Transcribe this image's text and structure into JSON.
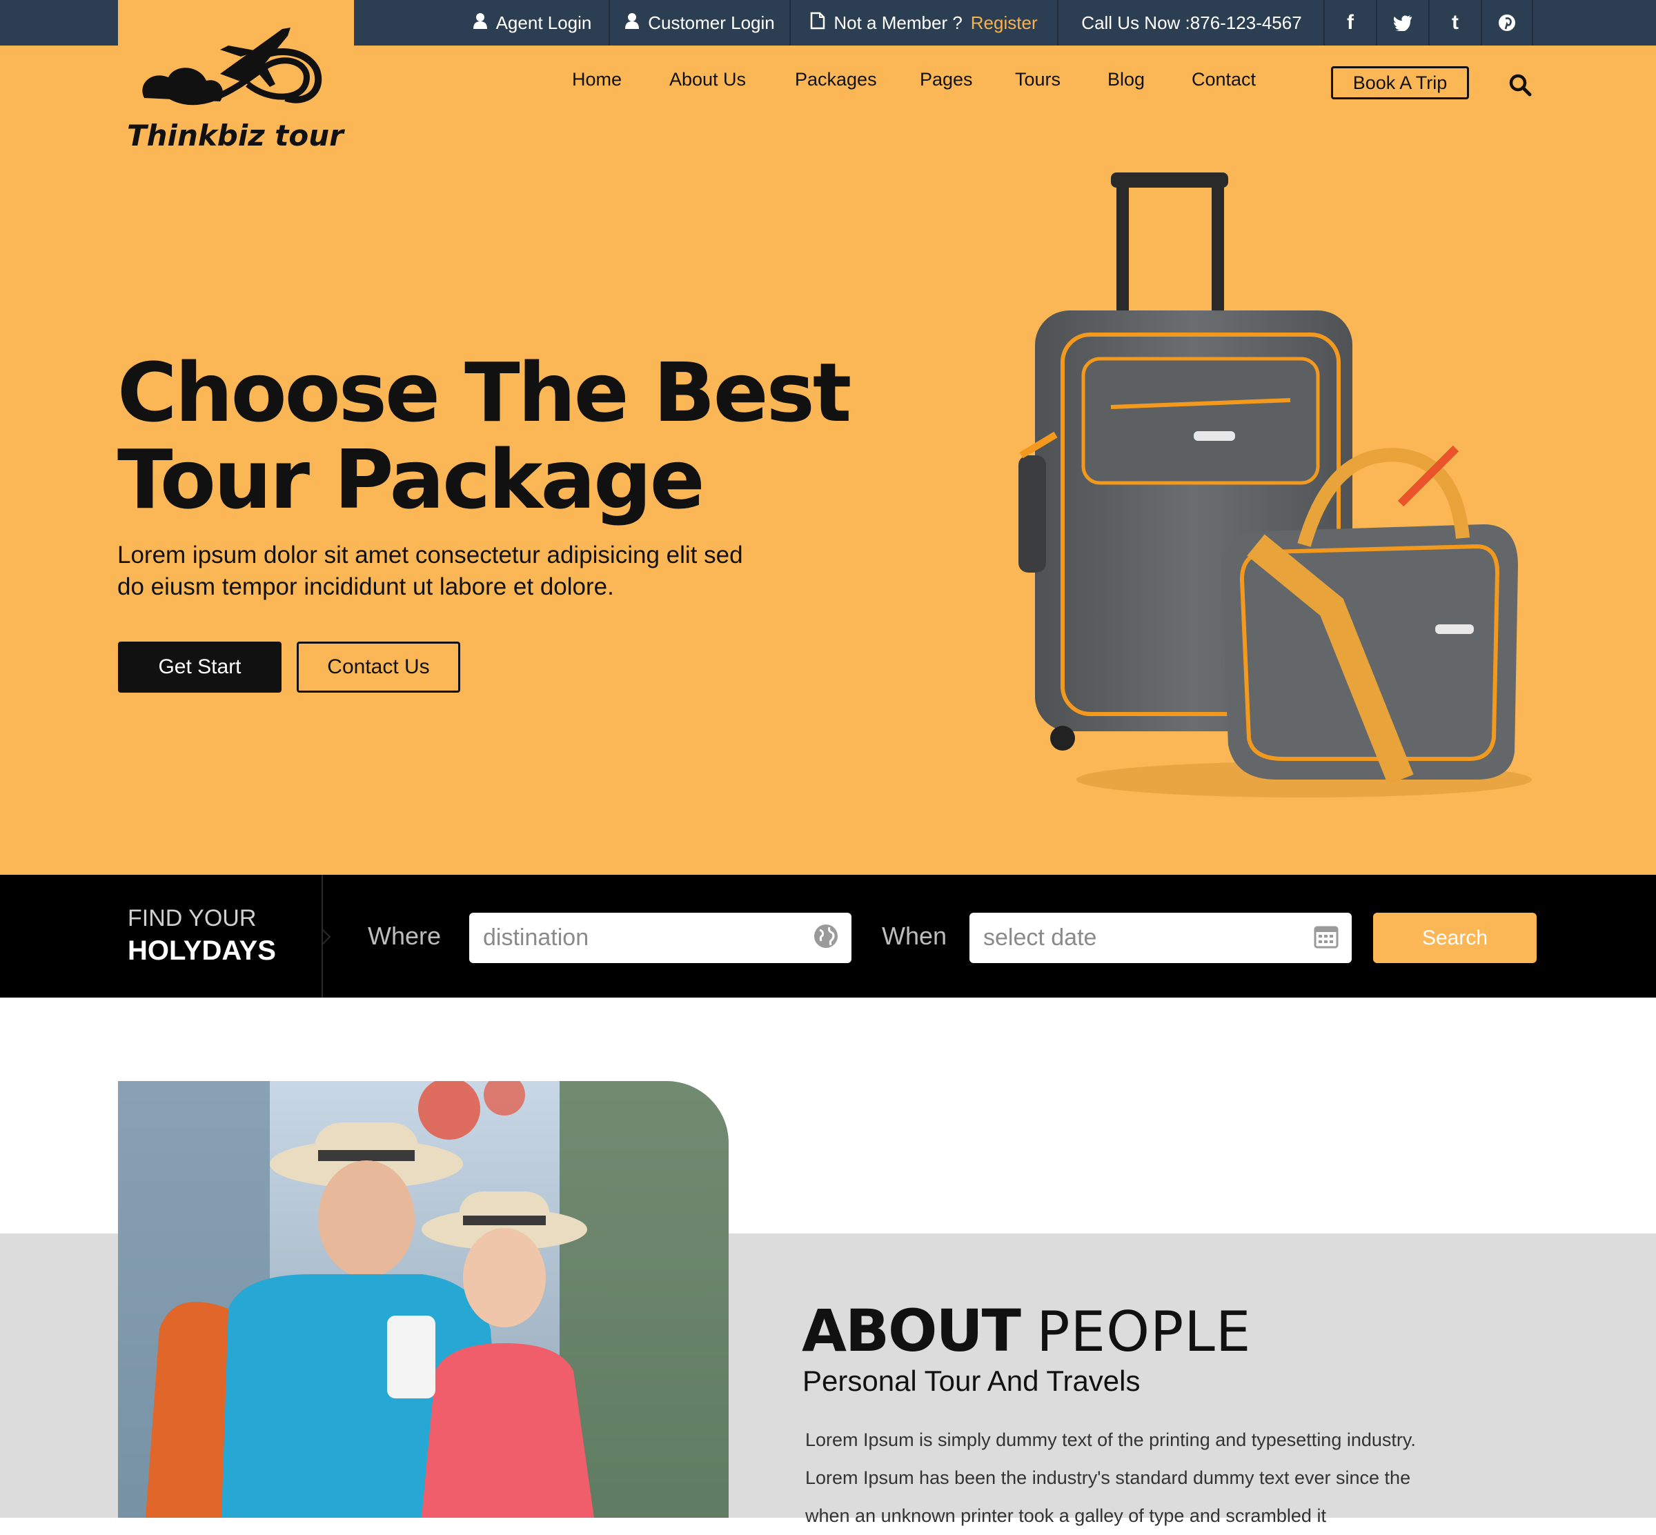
{
  "topbar": {
    "agent_login": "Agent Login",
    "customer_login": "Customer Login",
    "not_member": "Not a Member ?",
    "register": "Register",
    "call": "Call Us Now :876-123-4567"
  },
  "brand": {
    "name": "Thinkbiz tour"
  },
  "nav": {
    "home": "Home",
    "about": "About Us",
    "packages": "Packages",
    "pages": "Pages",
    "tours": "Tours",
    "blog": "Blog",
    "contact": "Contact",
    "book": "Book A Trip"
  },
  "hero": {
    "title_line1": "Choose The Best",
    "title_line2": "Tour Package",
    "subtitle_line1": "Lorem ipsum dolor sit amet consectetur adipisicing elit sed",
    "subtitle_line2": "do eiusm tempor incididunt ut labore et dolore.",
    "primary_btn": "Get Start",
    "secondary_btn": "Contact Us"
  },
  "search": {
    "heading_small": "FIND YOUR",
    "heading_big": "HOLYDAYS",
    "where_label": "Where",
    "where_placeholder": "distination",
    "when_label": "When",
    "when_placeholder": "select date",
    "button": "Search"
  },
  "about": {
    "title_bold": "ABOUT",
    "title_light": "PEOPLE",
    "subtitle": "Personal Tour And Travels",
    "text": "Lorem Ipsum is simply dummy text of the printing and typesetting industry. Lorem Ipsum has been the industry's standard dummy text ever since the when an unknown printer took a galley of type and scrambled it"
  },
  "colors": {
    "accent": "#fbb655",
    "topbar": "#2c3e52",
    "dark": "#000000"
  },
  "icons": [
    "user-icon",
    "document-icon",
    "facebook-icon",
    "twitter-icon",
    "tumblr-icon",
    "pinterest-icon",
    "search-icon",
    "globe-icon",
    "calendar-icon"
  ]
}
